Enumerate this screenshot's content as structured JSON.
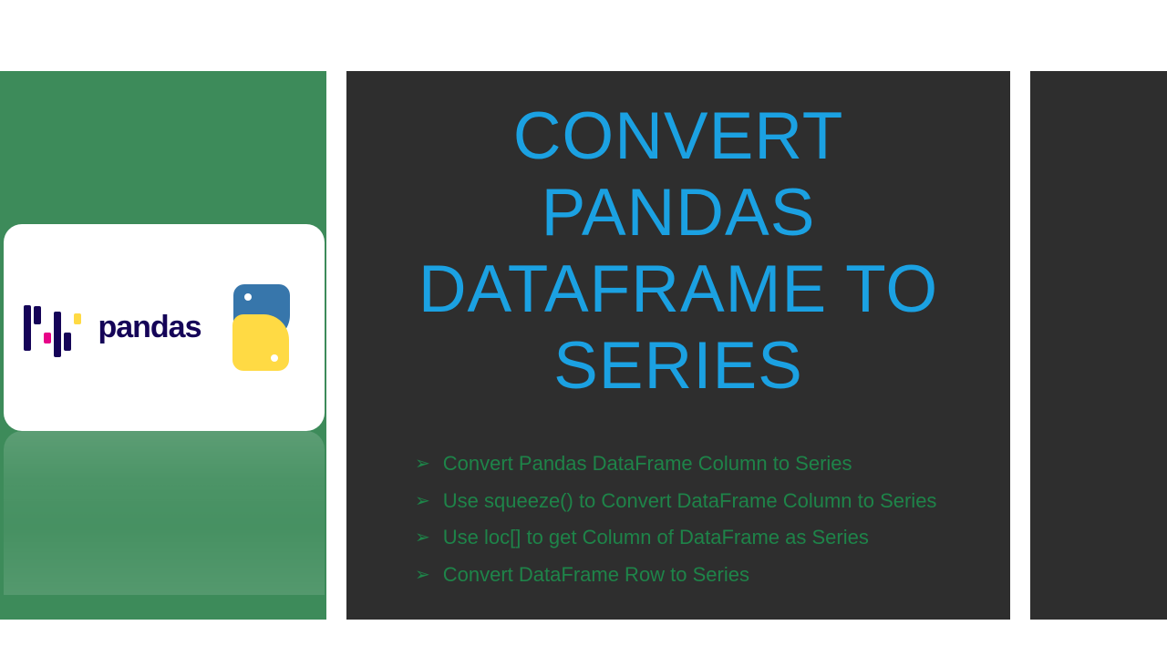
{
  "title_line1": "CONVERT PANDAS",
  "title_line2": "DATAFRAME TO SERIES",
  "pandas_label": "pandas",
  "bullets": [
    "Convert Pandas DataFrame Column to Series",
    "Use squeeze() to Convert DataFrame Column to Series",
    "Use loc[] to get Column of DataFrame as Series",
    "Convert DataFrame Row to Series"
  ]
}
